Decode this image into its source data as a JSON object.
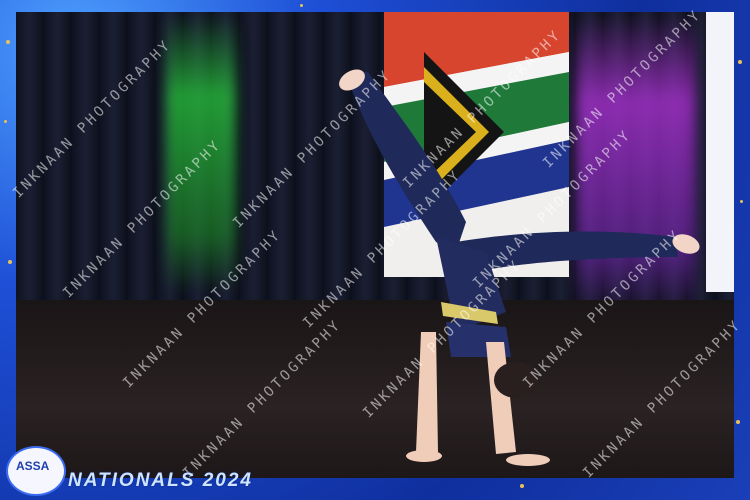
{
  "frame": {
    "event_title": "NATIONALS 2024",
    "logo_text": "ASSA"
  },
  "watermark": {
    "text": "INKNAAN PHOTOGRAPHY"
  },
  "colors": {
    "frame_blue": "#1a3fb8",
    "stage_floor": "#2a2223",
    "leotard_navy": "#1f2a5a",
    "green_light": "#28c83c",
    "purple_light": "#aa32d2"
  }
}
